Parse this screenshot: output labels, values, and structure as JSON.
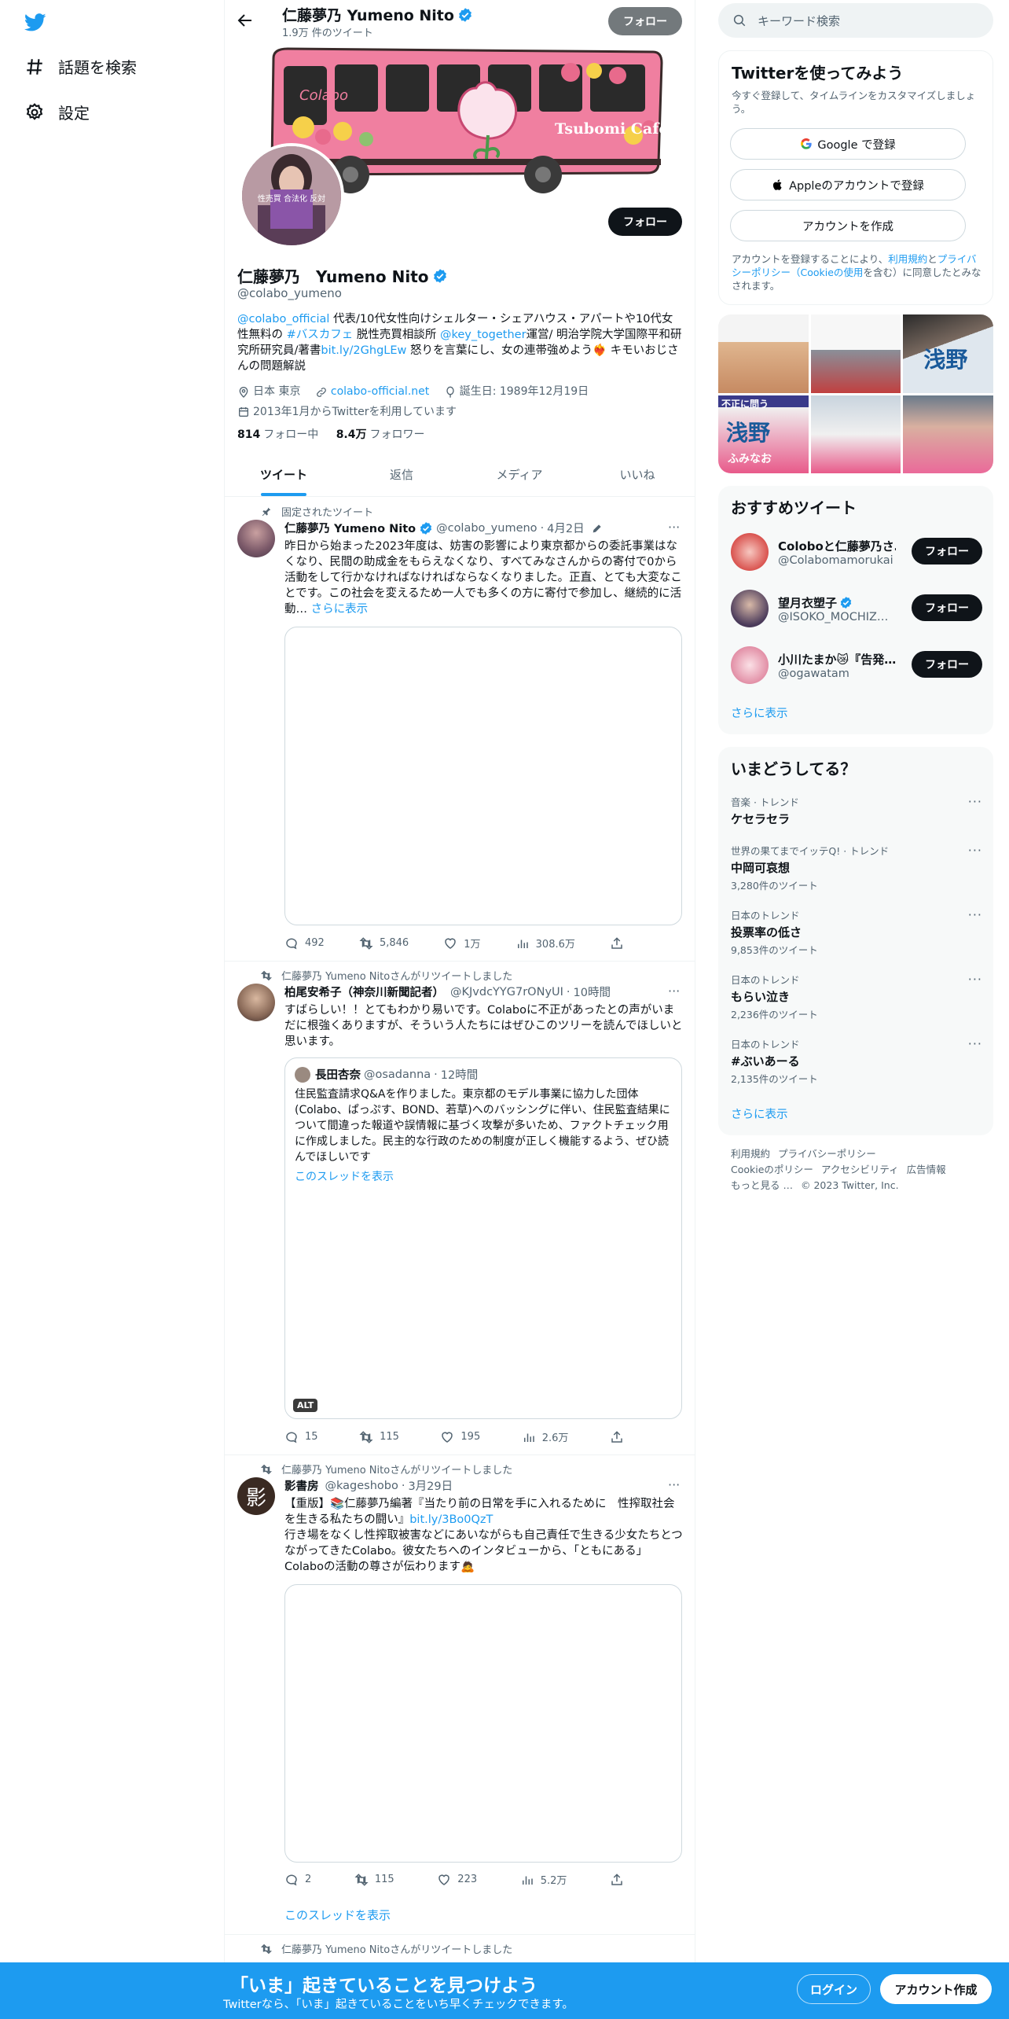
{
  "nav": {
    "explore_label": "話題を検索",
    "settings_label": "設定"
  },
  "header": {
    "name": "仁藤夢乃 Yumeno Nito",
    "tweet_count": "1.9万 件のツイート",
    "follow_label": "フォロー"
  },
  "banner": {
    "brand": "Colabo",
    "cafe_sign": "Tsubomi Cafe"
  },
  "avatar": {
    "sign_text": "性売買 合法化 反対"
  },
  "profile": {
    "follow_label": "フォロー",
    "name": "仁藤夢乃　Yumeno Nito",
    "handle": "@colabo_yumeno",
    "bio": {
      "mention1": "@colabo_official",
      "t1": " 代表/10代女性向けシェルター・シェアハウス・アパートや10代女性無料の ",
      "hashtag": "#バスカフェ",
      "t2": " 脱性売買相談所 ",
      "mention2": "@key_together",
      "t3": "運営/ 明治学院大学国際平和研究所研究員/著書",
      "link": "bit.ly/2GhgLEw",
      "t4": " 怒りを言葉にし、女の連帯強めよう❤️‍🔥 キモいおじさんの問題解説"
    },
    "location": "日本 東京",
    "website": "colabo-official.net",
    "birthday": "誕生日: 1989年12月19日",
    "joined": "2013年1月からTwitterを利用しています",
    "following_count": "814",
    "following_label": "フォロー中",
    "followers_count": "8.4万",
    "followers_label": "フォロワー"
  },
  "tabs": [
    {
      "label": "ツイート",
      "active": true
    },
    {
      "label": "返信",
      "active": false
    },
    {
      "label": "メディア",
      "active": false
    },
    {
      "label": "いいね",
      "active": false
    }
  ],
  "tweets": [
    {
      "social": "固定されたツイート",
      "name": "仁藤夢乃 Yumeno Nito",
      "handle": "@colabo_yumeno",
      "time": "4月2日",
      "text": "昨日から始まった2023年度は、妨害の影響により東京都からの委託事業はなくなり、民間の助成金をもらえなくなり、すべてみなさんからの寄付で0から活動をして行かなければなければならなくなりました。正直、とても大変なことです。この社会を変えるため一人でも多くの方に寄付で参加し、継続的に活動…",
      "show_more": "さらに表示",
      "replies": "492",
      "retweets": "5,846",
      "likes": "1万",
      "views": "308.6万"
    },
    {
      "social": "仁藤夢乃 Yumeno Nitoさんがリツイートしました",
      "name": "柏尾安希子（神奈川新聞記者）",
      "handle": "@KJvdcYYG7rONyUI",
      "time": "10時間",
      "text": "すばらしい！！とてもわかり易いです。Colaboに不正があったとの声がいまだに根強くありますが、そういう人たちにはぜひこのツリーを読んでほしいと思います。",
      "quote": {
        "name": "長田杏奈",
        "handle": "@osadanna",
        "time": "12時間",
        "text": "住民監査請求Q&Aを作りました。東京都のモデル事業に協力した団体(Colabo、ぱっぷす、BOND、若草)へのバッシングに伴い、住民監査結果について間違った報道や誤情報に基づく攻撃が多いため、ファクトチェック用に作成しました。民主的な行政のための制度が正しく機能するよう、ぜひ読んでほしいです",
        "thread_link": "このスレッドを表示",
        "alt": "ALT"
      },
      "replies": "15",
      "retweets": "115",
      "likes": "195",
      "views": "2.6万"
    },
    {
      "social": "仁藤夢乃 Yumeno Nitoさんがリツイートしました",
      "name": "影書房",
      "handle": "@kageshobo",
      "time": "3月29日",
      "avatar_char": "影",
      "text1": "【重版】📚仁藤夢乃編著『当たり前の日常を手に入れるために　性搾取社会を生きる私たちの闘い』",
      "link": "bit.ly/3Bo0QzT",
      "text2": "行き場をなくし性搾取被害などにあいながらも自己責任で生きる少女たちとつながってきたColabo。彼女たちへのインタビューから、「ともにある」Colaboの活動の尊さが伝わります🙇",
      "replies": "2",
      "retweets": "115",
      "likes": "223",
      "views": "5.2万",
      "thread_link": "このスレッドを表示"
    },
    {
      "social": "仁藤夢乃 Yumeno Nitoさんがリツイートしました"
    }
  ],
  "right": {
    "search_placeholder": "キーワード検索",
    "signup": {
      "title": "Twitterを使ってみよう",
      "subtitle": "今すぐ登録して、タイムラインをカスタマイズしましょう。",
      "google": "Google で登録",
      "apple": "Appleのアカウントで登録",
      "create": "アカウントを作成",
      "terms_pre": "アカウントを登録することにより、",
      "terms_link1": "利用規約",
      "terms_and": "と",
      "terms_link2": "プライバシーポリシー（Cookieの使用",
      "terms_post": "を含む）に同意したとみなされます。"
    },
    "photo_texts": [
      "不正に問う",
      "浅野",
      "ふみなお"
    ],
    "recommend": {
      "title": "おすすめツイート",
      "items": [
        {
          "name": "Coloboと仁藤夢乃さ…",
          "handle": "@Colabomamorukai",
          "verified": false,
          "follow": "フォロー",
          "color": "#d9534f"
        },
        {
          "name": "望月衣塑子",
          "handle": "@ISOKO_MOCHIZ…",
          "verified": true,
          "follow": "フォロー",
          "color": "#7a5a8c"
        },
        {
          "name": "小川たまか😿『告発…",
          "handle": "@ogawatam",
          "verified": false,
          "follow": "フォロー",
          "color": "#e28fa6"
        }
      ],
      "show_more": "さらに表示"
    },
    "trends": {
      "title": "いまどうしてる？",
      "items": [
        {
          "context": "音楽 · トレンド",
          "name": "ケセラセラ",
          "count": ""
        },
        {
          "context": "世界の果てまでイッテQ! · トレンド",
          "name": "中岡可哀想",
          "count": "3,280件のツイート"
        },
        {
          "context": "日本のトレンド",
          "name": "投票率の低さ",
          "count": "9,853件のツイート"
        },
        {
          "context": "日本のトレンド",
          "name": "もらい泣き",
          "count": "2,236件のツイート"
        },
        {
          "context": "日本のトレンド",
          "name": "#ぶいあーる",
          "count": "2,135件のツイート"
        }
      ],
      "show_more": "さらに表示"
    },
    "footer": {
      "line1a": "利用規約",
      "line1b": "プライバシーポリシー",
      "line2a": "Cookieのポリシー",
      "line2b": "アクセシビリティ",
      "line2c": "広告情報",
      "line3a": "もっと見る …",
      "line3b": "© 2023 Twitter, Inc."
    }
  },
  "bottom": {
    "title": "「いま」起きていることを見つけよう",
    "subtitle": "Twitterなら、「いま」起きていることをいち早くチェックできます。",
    "login": "ログイン",
    "signup": "アカウント作成"
  },
  "colors": {
    "accent": "#1d9bf0",
    "text": "#0f1419",
    "secondary": "#536471",
    "bus_pink": "#f07fa0"
  }
}
